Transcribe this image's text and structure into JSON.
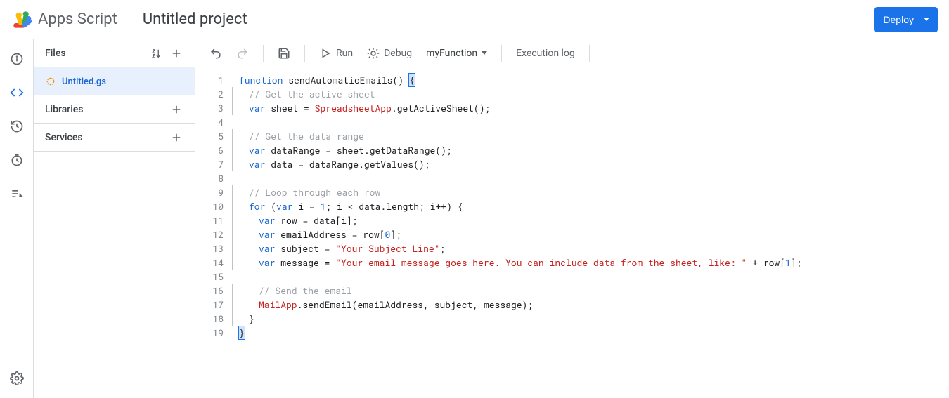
{
  "header": {
    "product": "Apps Script",
    "project_title": "Untitled project",
    "deploy_label": "Deploy"
  },
  "rail": {
    "items": [
      "info",
      "editor",
      "triggers",
      "executions",
      "project-settings"
    ],
    "bottom": "settings"
  },
  "files": {
    "header_label": "Files",
    "items": [
      {
        "name": "Untitled.gs",
        "active": true
      }
    ],
    "libraries_label": "Libraries",
    "services_label": "Services"
  },
  "toolbar": {
    "run_label": "Run",
    "debug_label": "Debug",
    "function_selected": "myFunction",
    "execution_log_label": "Execution log"
  },
  "code": {
    "lines": [
      [
        [
          "kw",
          "function"
        ],
        [
          "sp",
          " "
        ],
        [
          "fn",
          "sendAutomaticEmails"
        ],
        [
          "punc",
          "()"
        ],
        [
          "sp",
          " "
        ],
        [
          "cur",
          "{"
        ]
      ],
      [
        [
          "ind",
          1
        ],
        [
          "comment",
          "// Get the active sheet"
        ]
      ],
      [
        [
          "ind",
          1
        ],
        [
          "kw",
          "var"
        ],
        [
          "sp",
          " "
        ],
        [
          "fn",
          "sheet"
        ],
        [
          "sp",
          " "
        ],
        [
          "punc",
          "="
        ],
        [
          "sp",
          " "
        ],
        [
          "type",
          "SpreadsheetApp"
        ],
        [
          "punc",
          "."
        ],
        [
          "fn",
          "getActiveSheet"
        ],
        [
          "punc",
          "();"
        ]
      ],
      [],
      [
        [
          "ind",
          1
        ],
        [
          "comment",
          "// Get the data range"
        ]
      ],
      [
        [
          "ind",
          1
        ],
        [
          "kw",
          "var"
        ],
        [
          "sp",
          " "
        ],
        [
          "fn",
          "dataRange"
        ],
        [
          "sp",
          " "
        ],
        [
          "punc",
          "="
        ],
        [
          "sp",
          " "
        ],
        [
          "fn",
          "sheet"
        ],
        [
          "punc",
          "."
        ],
        [
          "fn",
          "getDataRange"
        ],
        [
          "punc",
          "();"
        ]
      ],
      [
        [
          "ind",
          1
        ],
        [
          "kw",
          "var"
        ],
        [
          "sp",
          " "
        ],
        [
          "fn",
          "data"
        ],
        [
          "sp",
          " "
        ],
        [
          "punc",
          "="
        ],
        [
          "sp",
          " "
        ],
        [
          "fn",
          "dataRange"
        ],
        [
          "punc",
          "."
        ],
        [
          "fn",
          "getValues"
        ],
        [
          "punc",
          "();"
        ]
      ],
      [],
      [
        [
          "ind",
          1
        ],
        [
          "comment",
          "// Loop through each row"
        ]
      ],
      [
        [
          "ind",
          1
        ],
        [
          "kw",
          "for"
        ],
        [
          "sp",
          " "
        ],
        [
          "punc",
          "("
        ],
        [
          "kw",
          "var"
        ],
        [
          "sp",
          " "
        ],
        [
          "fn",
          "i"
        ],
        [
          "sp",
          " "
        ],
        [
          "punc",
          "="
        ],
        [
          "sp",
          " "
        ],
        [
          "num",
          "1"
        ],
        [
          "punc",
          ";"
        ],
        [
          "sp",
          " "
        ],
        [
          "fn",
          "i"
        ],
        [
          "sp",
          " "
        ],
        [
          "punc",
          "<"
        ],
        [
          "sp",
          " "
        ],
        [
          "fn",
          "data"
        ],
        [
          "punc",
          "."
        ],
        [
          "fn",
          "length"
        ],
        [
          "punc",
          ";"
        ],
        [
          "sp",
          " "
        ],
        [
          "fn",
          "i"
        ],
        [
          "punc",
          "++)"
        ],
        [
          "sp",
          " "
        ],
        [
          "punc",
          "{"
        ]
      ],
      [
        [
          "ind",
          2
        ],
        [
          "kw",
          "var"
        ],
        [
          "sp",
          " "
        ],
        [
          "fn",
          "row"
        ],
        [
          "sp",
          " "
        ],
        [
          "punc",
          "="
        ],
        [
          "sp",
          " "
        ],
        [
          "fn",
          "data"
        ],
        [
          "punc",
          "["
        ],
        [
          "fn",
          "i"
        ],
        [
          "punc",
          "];"
        ]
      ],
      [
        [
          "ind",
          2
        ],
        [
          "kw",
          "var"
        ],
        [
          "sp",
          " "
        ],
        [
          "fn",
          "emailAddress"
        ],
        [
          "sp",
          " "
        ],
        [
          "punc",
          "="
        ],
        [
          "sp",
          " "
        ],
        [
          "fn",
          "row"
        ],
        [
          "punc",
          "["
        ],
        [
          "num",
          "0"
        ],
        [
          "punc",
          "];"
        ]
      ],
      [
        [
          "ind",
          2
        ],
        [
          "kw",
          "var"
        ],
        [
          "sp",
          " "
        ],
        [
          "fn",
          "subject"
        ],
        [
          "sp",
          " "
        ],
        [
          "punc",
          "="
        ],
        [
          "sp",
          " "
        ],
        [
          "str",
          "\"Your Subject Line\""
        ],
        [
          "punc",
          ";"
        ]
      ],
      [
        [
          "ind",
          2
        ],
        [
          "kw",
          "var"
        ],
        [
          "sp",
          " "
        ],
        [
          "fn",
          "message"
        ],
        [
          "sp",
          " "
        ],
        [
          "punc",
          "="
        ],
        [
          "sp",
          " "
        ],
        [
          "str",
          "\"Your email message goes here. You can include data from the sheet, like: \""
        ],
        [
          "sp",
          " "
        ],
        [
          "punc",
          "+"
        ],
        [
          "sp",
          " "
        ],
        [
          "fn",
          "row"
        ],
        [
          "punc",
          "["
        ],
        [
          "num",
          "1"
        ],
        [
          "punc",
          "];"
        ]
      ],
      [],
      [
        [
          "ind",
          2
        ],
        [
          "comment",
          "// Send the email"
        ]
      ],
      [
        [
          "ind",
          2
        ],
        [
          "type",
          "MailApp"
        ],
        [
          "punc",
          "."
        ],
        [
          "fn",
          "sendEmail"
        ],
        [
          "punc",
          "("
        ],
        [
          "fn",
          "emailAddress"
        ],
        [
          "punc",
          ","
        ],
        [
          "sp",
          " "
        ],
        [
          "fn",
          "subject"
        ],
        [
          "punc",
          ","
        ],
        [
          "sp",
          " "
        ],
        [
          "fn",
          "message"
        ],
        [
          "punc",
          ");"
        ]
      ],
      [
        [
          "ind",
          1
        ],
        [
          "punc",
          "}"
        ]
      ],
      [
        [
          "cur",
          "}"
        ]
      ]
    ]
  }
}
